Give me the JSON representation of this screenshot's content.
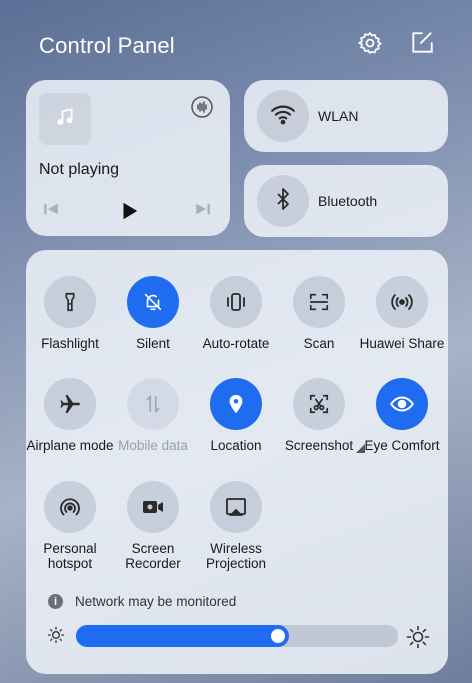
{
  "header": {
    "title": "Control Panel",
    "settings_icon": "gear-icon",
    "edit_icon": "edit-icon"
  },
  "media": {
    "title": "Not playing",
    "album_icon": "music-note-icon",
    "audio_output_icon": "audio-output-icon",
    "controls": [
      "previous-icon",
      "play-icon",
      "next-icon"
    ]
  },
  "connections": {
    "wlan": {
      "label": "WLAN",
      "icon": "wifi-icon"
    },
    "bluetooth": {
      "label": "Bluetooth",
      "icon": "bluetooth-icon"
    }
  },
  "tiles": [
    {
      "label": "Flashlight",
      "icon": "flashlight-icon",
      "state": "off"
    },
    {
      "label": "Silent",
      "icon": "bell-off-icon",
      "state": "on"
    },
    {
      "label": "Auto-rotate",
      "icon": "rotate-icon",
      "state": "off"
    },
    {
      "label": "Scan",
      "icon": "scan-icon",
      "state": "off"
    },
    {
      "label": "Huawei Share",
      "icon": "share-icon",
      "state": "off"
    },
    {
      "label": "Airplane mode",
      "icon": "airplane-icon",
      "state": "off"
    },
    {
      "label": "Mobile data",
      "icon": "mobile-data-icon",
      "state": "disabled"
    },
    {
      "label": "Location",
      "icon": "location-icon",
      "state": "on"
    },
    {
      "label": "Screenshot",
      "icon": "screenshot-icon",
      "state": "off"
    },
    {
      "label": "Eye Comfort",
      "icon": "eye-icon",
      "state": "on"
    },
    {
      "label": "Personal hotspot",
      "icon": "hotspot-icon",
      "state": "off"
    },
    {
      "label": "Screen Recorder",
      "icon": "screen-recorder-icon",
      "state": "off"
    },
    {
      "label": "Wireless Projection",
      "icon": "projection-icon",
      "state": "off"
    }
  ],
  "notice": {
    "text": "Network may be monitored",
    "icon": "info-icon"
  },
  "brightness": {
    "level": 0.66,
    "icons": [
      "sun-low-icon",
      "sun-high-icon"
    ]
  },
  "colors": {
    "accent": "#1f6cf0",
    "tile_off": "#c3c9d6",
    "text": "#1a1a1a"
  }
}
